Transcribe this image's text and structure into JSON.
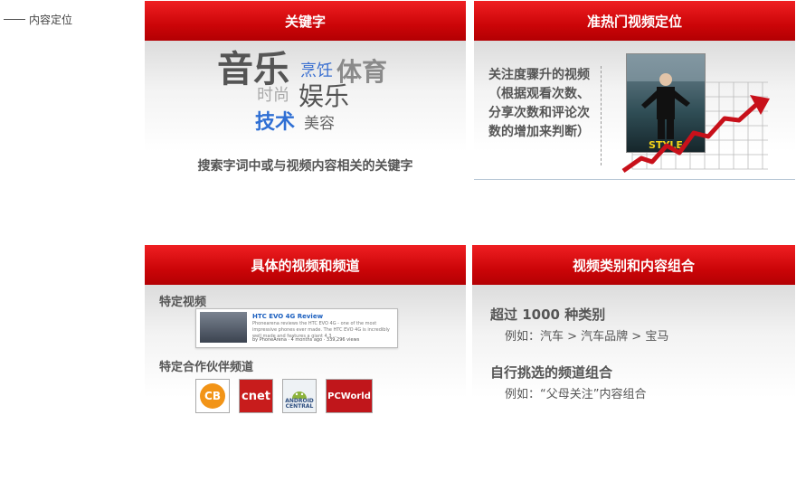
{
  "side_label": "内容定位",
  "cards": {
    "keywords": {
      "title": "关键字",
      "words": {
        "music": "音乐",
        "cooking": "烹饪",
        "sports": "体育",
        "fashion": "时尚",
        "entertainment": "娱乐",
        "tech": "技术",
        "beauty": "美容"
      },
      "caption": "搜索字词中或与视频内容相关的关键字"
    },
    "trending": {
      "title": "准热门视频定位",
      "description": "关注度骤升的视频（根据观看次数、分享次数和评论次数的增加来判断）"
    },
    "videos": {
      "title": "具体的视频和频道",
      "specific_video_label": "特定视频",
      "video_title": "HTC EVO 4G Review",
      "video_desc": "Phonearena reviews the HTC EVO 4G - one of the most impressive phones ever made. The HTC EVO 4G is incredibly well made and features a giant 4.3 ...",
      "video_meta": "by PhoneArena · 4 months ago · 339,296 views",
      "partner_label": "特定合作伙伴频道",
      "partner_logos": [
        "CB",
        "cnet",
        "ANDROID CENTRAL",
        "PCWorld"
      ]
    },
    "category": {
      "title": "视频类别和内容组合",
      "line1": "超过 1000 种类别",
      "line1_example": "例如：汽车 > 汽车品牌 > 宝马",
      "line2": "自行挑选的频道组合",
      "line2_example": "例如：“父母关注”内容组合"
    }
  },
  "colors": {
    "header_red": "#cc0508",
    "text_gray": "#555555",
    "keyword_blue": "#2f6fd4",
    "trend_arrow": "#c8101a"
  }
}
